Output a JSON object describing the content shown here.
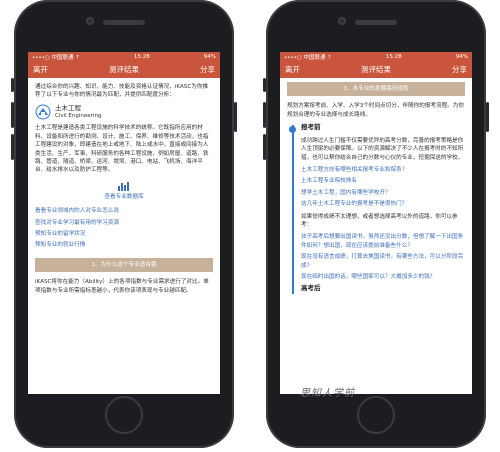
{
  "left": {
    "status": {
      "carrier": "••••○ 中国联通 ⇡",
      "time": "15:28",
      "battery": "94%"
    },
    "nav": {
      "back": "离开",
      "title": "测评结果",
      "share": "分享"
    },
    "intro": "通过综合你的兴趣、知识、能力、技能及资格认证情况，iKASC为你推荐了以下专业与你的情况最为匹配，并提供匹配度分析：",
    "major": {
      "name": "土木工程",
      "en": "Civil Engineering"
    },
    "description": "土木工程是建造各类工程设施的科学技术的统称。它既指所应用的材料、设备和所进行的勘测、设计、施工、保养、维修等技术活动，也指工程建设的对象，即建造在地上或地下、陆上或水中，直接或间接为人类生活、生产、军事、科研服务的各种工程设施，例如房屋、道路、铁路、管道、隧道、桥梁、运河、堤坝、港口、电站、飞机场、海洋平台、给水排水以及防护工程等。",
    "database_label": "查看专业数据库",
    "links": [
      "看看专业领域内的人对专业怎么说",
      "查找对专业学习最有用的学习资源",
      "预知专业的留学状况",
      "预知专业的就业行情"
    ],
    "section1": "1、为什么这个专业适合我",
    "bottom": "iKASC将你在能力（Ability）上的各项指数与专业需求进行了对比。单项指数与专业所需指标差越小，代表你该项表现与专业越匹配。"
  },
  "right": {
    "status": {
      "carrier": "••••○ 中国联通 ⇡",
      "time": "15:28",
      "battery": "94%"
    },
    "nav": {
      "back": "离开",
      "title": "测评结果",
      "share": "分享"
    },
    "section3": "3、本专业的发展路径规划",
    "intro": "规划方案按考前、入学、入学3个时间点切分，伴随你的报考流程。为你规划合理的专业选择与成长路线。",
    "step1": "报考前",
    "step1_text": "成功跨过人生门槛不仅需要优异的高考分数，完善的报考策略是你人生顶梁的必要保障。以下的资源解决了不少人在报考时的不知所措，也可以帮你结合自己的分数与心仪的专业，挖掘保送的学校。",
    "links": [
      "土木工程方向有哪些相关报考专业和院系？",
      "土木工程专业院校排名",
      "想学土木工程，国内有哪些学校开？",
      "这几年土木工程专业的报考是不是很热门？"
    ],
    "q_intro": "如果觉得成绩不太理想，或者想选择高考以外的道路，你可以参考：",
    "q_links": [
      "孩子高考后想要出国读书，虽然还没出分数，但想了解一下出国条件如何？想出国，现在应该提前准备些什么？",
      "现在没有语言成绩，打算去美国读书，有哪些方法，可以分阶段完成？",
      "现在临时出国的话，哪些国家可以？大概加多少的钱？"
    ],
    "step2": "高考后",
    "watermark": "思知人学前"
  }
}
